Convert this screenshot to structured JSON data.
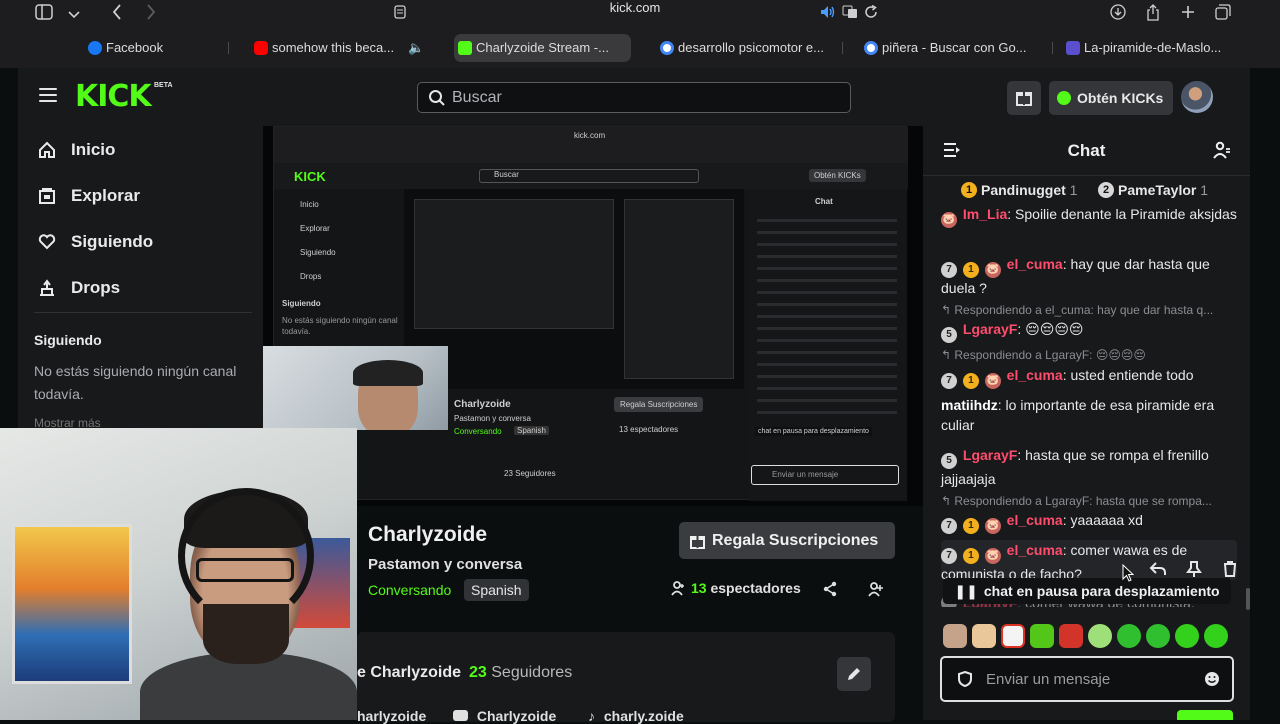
{
  "browser": {
    "url": "kick.com",
    "tabs": [
      {
        "label": "Facebook",
        "color": "#1877f2"
      },
      {
        "label": "somehow this beca...",
        "color": "#ff0000"
      },
      {
        "label": "Charlyzoide Stream -...",
        "color": "#53fc18"
      },
      {
        "label": "desarrollo psicomotor e...",
        "color": "#4285f4"
      },
      {
        "label": "piñera - Buscar con Go...",
        "color": "#4285f4"
      },
      {
        "label": "La-piramide-de-Maslo...",
        "color": "#5a4fcf"
      }
    ]
  },
  "header": {
    "logo": "KICK",
    "logo_badge": "BETA",
    "search_placeholder": "Buscar",
    "kicks_label": "Obtén KICKs"
  },
  "sidebar": {
    "items": [
      {
        "label": "Inicio",
        "icon": "home-icon"
      },
      {
        "label": "Explorar",
        "icon": "compass-icon"
      },
      {
        "label": "Siguiendo",
        "icon": "heart-icon"
      },
      {
        "label": "Drops",
        "icon": "drops-icon"
      }
    ],
    "following_title": "Siguiendo",
    "following_empty": "No estás siguiendo ningún canal todavía.",
    "show_more": "Mostrar más"
  },
  "stream": {
    "streamer": "Charlyzoide",
    "title": "Pastamon y conversa",
    "category": "Conversando",
    "language": "Spanish",
    "gift_subs": "Regala Suscripciones",
    "viewers_count": "13",
    "viewers_label": "espectadores",
    "about_name": "e Charlyzoide",
    "followers_count": "23",
    "followers_label": "Seguidores",
    "socials": [
      "harlyzoide",
      "Charlyzoide",
      "charly.zoide"
    ]
  },
  "nested_preview": {
    "url": "kick.com",
    "search": "Buscar",
    "kicks": "Obtén KICKs",
    "nav": [
      "Inicio",
      "Explorar",
      "Siguiendo",
      "Drops"
    ],
    "following_title": "Siguiendo",
    "following_empty": "No estás siguiendo ningún canal todavía.",
    "streamer": "Charlyzoide",
    "title": "Pastamon y conversa",
    "category": "Conversando",
    "language": "Spanish",
    "gift": "Regala Suscripciones",
    "viewers": "13 espectadores",
    "followers": "23 Seguidores",
    "chat_title": "Chat",
    "paused": "chat en pausa para desplazamiento",
    "input": "Enviar un mensaje"
  },
  "chat": {
    "title": "Chat",
    "gifters": [
      {
        "rank": "1",
        "name": "Pandinugget",
        "count": "1"
      },
      {
        "rank": "2",
        "name": "PameTaylor",
        "count": "1"
      }
    ],
    "messages": [
      {
        "badge": "",
        "user": "Im_Lia",
        "color": "#ff4d6d",
        "text": ": Spoilie denante la Piramide aksjdas"
      },
      {
        "badge": "7",
        "user": "el_cuma",
        "color": "#ff4d6d",
        "text": ": hay que dar hasta que duela ?"
      },
      {
        "reply": "Respondiendo a el_cuma: hay que dar hasta q..."
      },
      {
        "badge": "5",
        "user": "LgarayF",
        "color": "#ff4d6d",
        "text": ": 😔😔😔😔"
      },
      {
        "reply": "Respondiendo a LgarayF: 😔😔😔😔"
      },
      {
        "badge": "7",
        "user": "el_cuma",
        "color": "#ff4d6d",
        "text": ": usted entiende todo"
      },
      {
        "badge": "",
        "user": "matiihdz",
        "color": "#ffffff",
        "text": ": lo importante de esa piramide era culiar"
      },
      {
        "badge": "5",
        "user": "LgarayF",
        "color": "#ff4d6d",
        "text": ": hasta que se rompa el frenillo jajjaajaja"
      },
      {
        "reply": "Respondiendo a LgarayF: hasta que se rompa..."
      },
      {
        "badge": "7",
        "user": "el_cuma",
        "color": "#ff4d6d",
        "text": ": yaaaaaa xd"
      },
      {
        "badge": "7",
        "user": "el_cuma",
        "color": "#ff4d6d",
        "text": ": comer wawa es de comunista o de facho?"
      },
      {
        "badge": "",
        "user": "LgarayF",
        "color": "#ff4d6d",
        "text": ": comer wawa de comunista,"
      }
    ],
    "paused_label": "chat en pausa para desplazamiento",
    "input_placeholder": "Enviar un mensaje"
  }
}
